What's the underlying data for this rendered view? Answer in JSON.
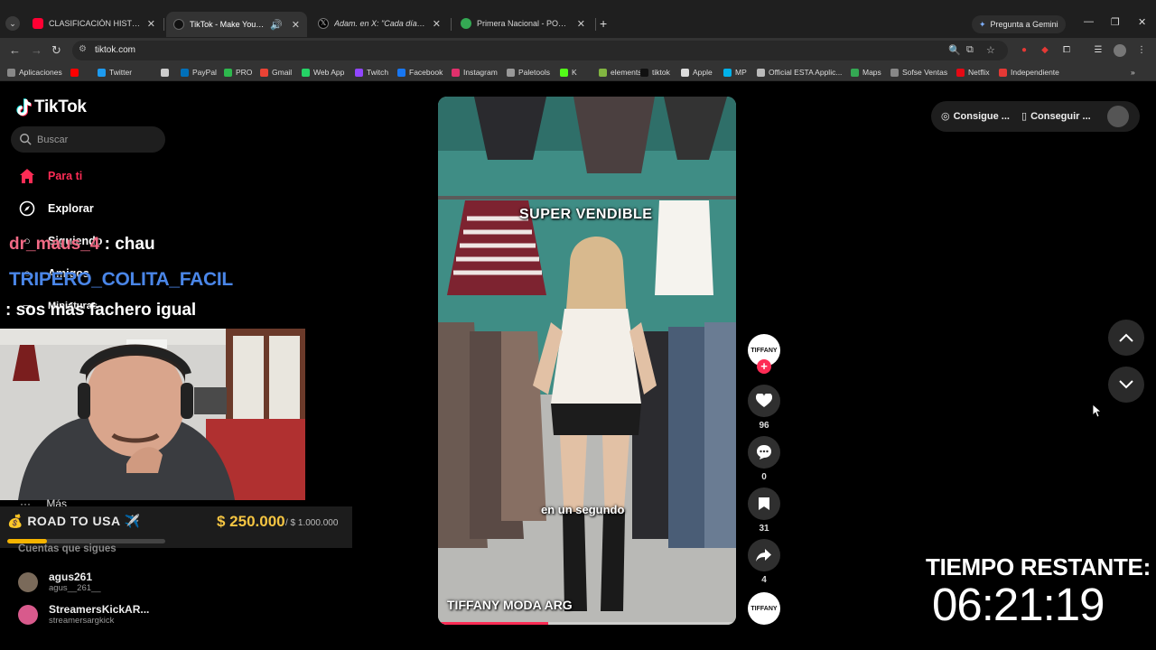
{
  "browser": {
    "tabs": [
      {
        "title": "CLASIFICACIÓN HISTÓRICA A C",
        "icon": "youtube-icon",
        "color": "#ff0033",
        "active": false
      },
      {
        "title": "TikTok - Make Your Day",
        "icon": "tiktok-icon",
        "color": "#111111",
        "active": true
      },
      {
        "title": "Adam. en X: \"Cada día se va ne",
        "icon": "x-icon",
        "color": "#000000",
        "active": false
      },
      {
        "title": "Primera Nacional - POSICIONES",
        "icon": "sheets-icon",
        "color": "#34a853",
        "active": false
      }
    ],
    "gemini_label": "Pregunta a Gemini",
    "url": "tiktok.com",
    "bookmarks": [
      {
        "label": "Aplicaciones",
        "color": "#888888"
      },
      {
        "label": "",
        "color": "#ff0000"
      },
      {
        "label": "Twitter",
        "color": "#1d9bf0"
      },
      {
        "label": "",
        "color": "#cccccc"
      },
      {
        "label": "PayPal",
        "color": "#0070ba"
      },
      {
        "label": "PRO",
        "color": "#2db84d"
      },
      {
        "label": "Gmail",
        "color": "#ea4335"
      },
      {
        "label": "Web App",
        "color": "#25d366"
      },
      {
        "label": "Twitch",
        "color": "#9146ff"
      },
      {
        "label": "Facebook",
        "color": "#1877f2"
      },
      {
        "label": "Instagram",
        "color": "#e1306c"
      },
      {
        "label": "Paletools",
        "color": "#999999"
      },
      {
        "label": "K",
        "color": "#53fc18"
      },
      {
        "label": "elements",
        "color": "#82b541"
      },
      {
        "label": "tiktok",
        "color": "#111111"
      },
      {
        "label": "Apple",
        "color": "#dddddd"
      },
      {
        "label": "MP",
        "color": "#00b1ea"
      },
      {
        "label": "Official ESTA Applic...",
        "color": "#bbbbbb"
      },
      {
        "label": "Maps",
        "color": "#34a853"
      },
      {
        "label": "Sofse Ventas",
        "color": "#888888"
      },
      {
        "label": "Netflix",
        "color": "#e50914"
      },
      {
        "label": "Independiente",
        "color": "#e53935"
      }
    ]
  },
  "tiktok": {
    "logo": "TikTok",
    "search_placeholder": "Buscar",
    "nav": [
      {
        "label": "Para ti",
        "icon": "home-icon"
      },
      {
        "label": "Explorar",
        "icon": "compass-icon"
      },
      {
        "label": "Siguiendo",
        "icon": "following-icon"
      },
      {
        "label": "Amigos",
        "icon": "friends-icon"
      },
      {
        "label": "Miniaturas",
        "icon": "tv-icon"
      }
    ],
    "more_label": "Más",
    "following_header": "Cuentas que sigues",
    "following": [
      {
        "name": "agus261",
        "handle": "agus__261__",
        "color": "#7a6a5a"
      },
      {
        "name": "StreamersKickAR...",
        "handle": "streamersargkick",
        "color": "#d85a8c"
      }
    ],
    "top_pill": {
      "btn1": "Consigue ...",
      "btn2": "Conseguir ..."
    },
    "video": {
      "caption_top": "SUPER VENDIBLE",
      "caption_bottom": "en un segundo",
      "author": "TIFFANY MODA ARG",
      "watermark": "TIFFANY",
      "progress_fraction": 0.37
    },
    "actions": {
      "avatar_label": "TIFFANY",
      "likes": "96",
      "comments": "0",
      "saves": "31",
      "shares": "4"
    }
  },
  "stream_overlay": {
    "chat": [
      {
        "user": "dr_maus_4",
        "message": " : chau"
      },
      {
        "user": "TRIPERO_COLITA_FACIL",
        "message": ": sos más fachero igual"
      }
    ],
    "goal_title": "💰 ROAD TO USA ✈️",
    "goal_current": "$ 250.000",
    "goal_target": "/ $ 1.000.000",
    "goal_fraction": 0.25,
    "timer_label": "TIEMPO RESTANTE:",
    "timer_value": "06:21:19"
  }
}
